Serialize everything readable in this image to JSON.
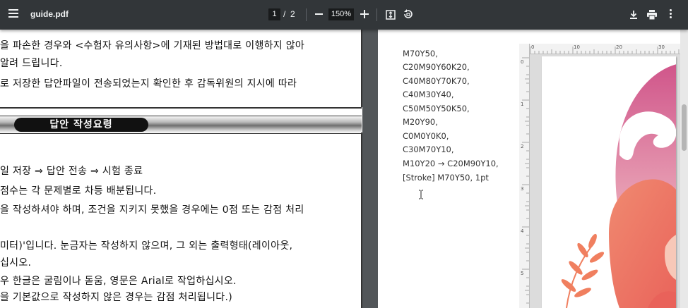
{
  "toolbar": {
    "title": "guide.pdf",
    "current_page": "1",
    "page_separator": "/",
    "total_pages": "2",
    "zoom": "150%",
    "icons": [
      "menu-icon",
      "minus-icon",
      "plus-icon",
      "fit-page-icon",
      "rotate-icon",
      "download-icon",
      "print-icon",
      "more-vert-icon"
    ]
  },
  "page1": {
    "lines_top": [
      "을 파손한 경우와 <수험자 유의사항>에 기재된 방법대로 이행하지 않아",
      " 알려 드립니다.",
      "로 저장한 답안파일이 전송되었는지 확인한 후 감독위원의 지시에 따라"
    ],
    "section_title": "답안 작성요령",
    "lines_bottom": [
      "일 저장 ⇒ 답안 전송 ⇒ 시험 종료",
      "점수는 각 문제별로 차등 배분됩니다.",
      "을 작성하셔야 하며, 조건을 지키지 못했을 경우에는 0점 또는 감점 처리",
      "미터)'입니다. 눈금자는 작성하지 않으며, 그 외는 출력형태(레이아웃,",
      "십시오.",
      "우 한글은 굴림이나 돋움, 영문은 Arial로 작업하십시오.",
      "을 기본값으로 작성하지 않은 경우는 감점 처리됩니다.)"
    ]
  },
  "page2": {
    "color_lines": [
      "M70Y50,",
      "C20M90Y60K20,",
      "C40M80Y70K70,",
      "C40M30Y40,",
      "C50M50Y50K50,",
      "M20Y90,",
      "C0M0Y0K0,",
      "C30M70Y10,",
      "M10Y20 → C20M90Y10,",
      "[Stroke] M70Y50, 1pt"
    ],
    "ruler_top_numbers": [
      "0",
      "10",
      "20",
      "30"
    ],
    "ruler_left_numbers": [
      "0",
      "1",
      "2",
      "3",
      "4",
      "5"
    ]
  },
  "colors": {
    "toolbar_bg": "#323639",
    "viewer_bg": "#525659",
    "art_pink": "#d0558a",
    "art_coral": "#ee7a62",
    "art_leaf": "#f07f5f"
  }
}
